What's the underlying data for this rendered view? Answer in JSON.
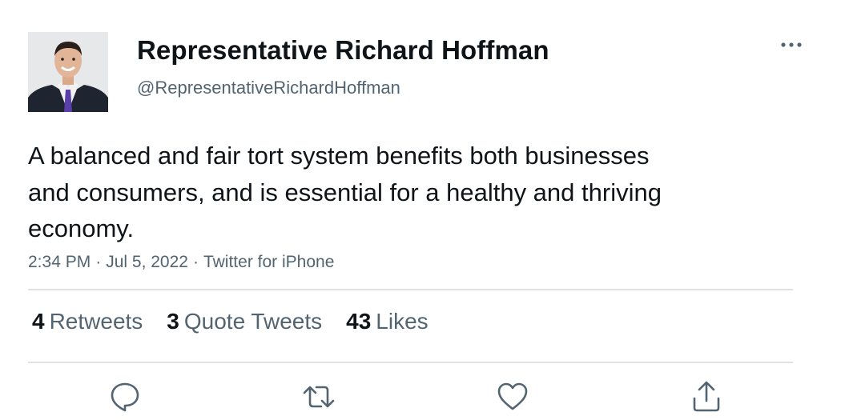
{
  "author": {
    "display_name": "Representative Richard Hoffman",
    "handle": "@RepresentativeRichardHoffman",
    "avatar_icon": "profile-photo"
  },
  "tweet": {
    "text": "A balanced and fair tort system benefits both businesses and consumers, and is essential for a healthy and thriving economy.",
    "time": "2:34 PM",
    "date": "Jul 5, 2022",
    "source": "Twitter for iPhone",
    "separator": "·"
  },
  "stats": {
    "retweets": {
      "count": "4",
      "label": "Retweets"
    },
    "quote_tweets": {
      "count": "3",
      "label": "Quote Tweets"
    },
    "likes": {
      "count": "43",
      "label": "Likes"
    }
  },
  "icons": {
    "more": "more-horizontal-icon",
    "reply": "reply-icon",
    "retweet": "retweet-icon",
    "like": "heart-icon",
    "share": "share-icon"
  },
  "colors": {
    "text_primary": "#0f1419",
    "text_secondary": "#536471",
    "divider": "#dfe1e4",
    "background": "#ffffff"
  }
}
